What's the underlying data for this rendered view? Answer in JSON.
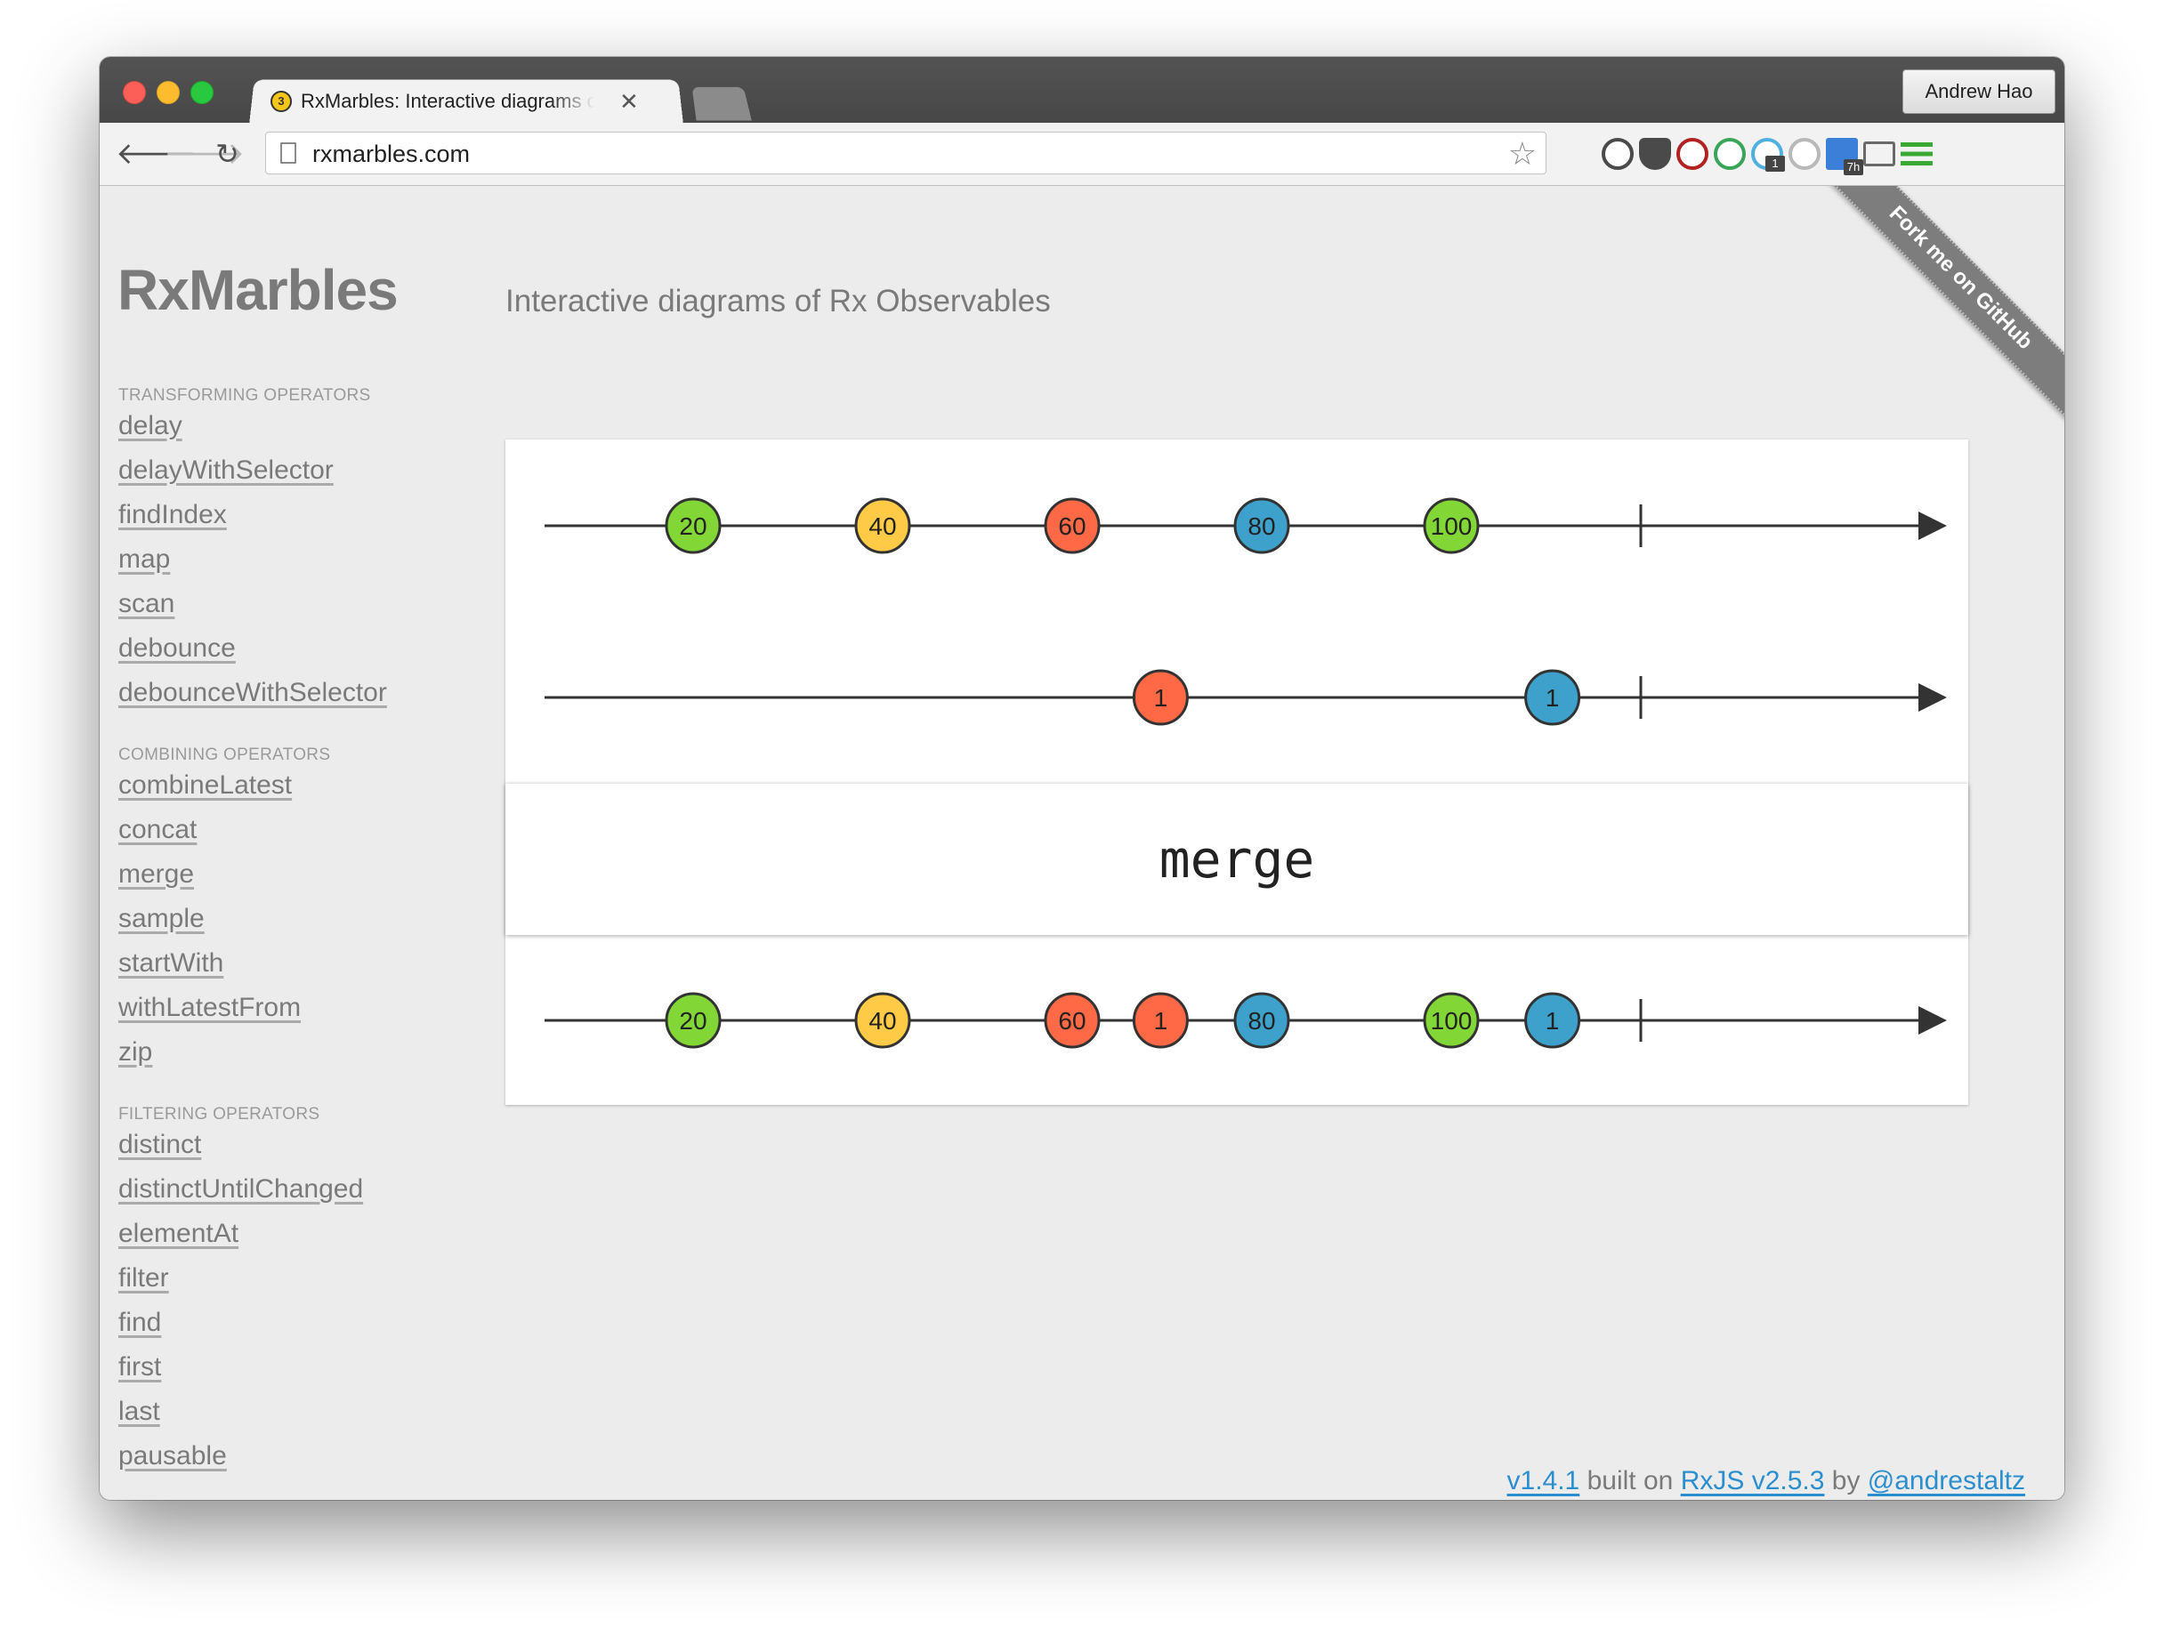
{
  "browser": {
    "tab_title": "RxMarbles: Interactive diagrams of Rx Observables",
    "tab_badge": "3",
    "profile_name": "Andrew Hao",
    "url": "rxmarbles.com",
    "extensions": [
      {
        "name": "1password-icon",
        "color": "#4a4a4a"
      },
      {
        "name": "pocket-icon",
        "color": "#4a4a4a"
      },
      {
        "name": "couch-icon",
        "color": "#b22222"
      },
      {
        "name": "pushbullet-icon",
        "color": "#3aa55a"
      },
      {
        "name": "ghostery-icon",
        "color": "#4fb0e0",
        "badge": "1"
      },
      {
        "name": "power-icon",
        "color": "#b8b8b8"
      },
      {
        "name": "calendar-icon",
        "color": "#3b7fd9",
        "badge": "7h"
      },
      {
        "name": "cast-icon",
        "color": "#6a6a6a"
      },
      {
        "name": "menu-icon",
        "color": "#3aaa35"
      }
    ]
  },
  "page": {
    "logo": "RxMarbles",
    "subtitle": "Interactive diagrams of Rx Observables",
    "ribbon": "Fork me on GitHub",
    "groups": [
      {
        "title": "TRANSFORMING OPERATORS",
        "items": [
          "delay",
          "delayWithSelector",
          "findIndex",
          "map",
          "scan",
          "debounce",
          "debounceWithSelector"
        ]
      },
      {
        "title": "COMBINING OPERATORS",
        "items": [
          "combineLatest",
          "concat",
          "merge",
          "sample",
          "startWith",
          "withLatestFrom",
          "zip"
        ]
      },
      {
        "title": "FILTERING OPERATORS",
        "items": [
          "distinct",
          "distinctUntilChanged",
          "elementAt",
          "filter",
          "find",
          "first",
          "last",
          "pausable"
        ]
      }
    ],
    "footer": {
      "version": "v1.4.1",
      "built_on": "built on",
      "rxjs": "RxJS v2.5.3",
      "by": "by",
      "author": "@andrestaltz"
    }
  },
  "diagram": {
    "operator": "merge",
    "colors": {
      "green": "#82d736",
      "yellow": "#ffcb46",
      "red": "#ff6946",
      "blue": "#3ea1cb"
    },
    "time_max": 100,
    "inputs": [
      {
        "marbles": [
          {
            "time": 5,
            "label": "20",
            "color": "green"
          },
          {
            "time": 20,
            "label": "40",
            "color": "yellow"
          },
          {
            "time": 35,
            "label": "60",
            "color": "red"
          },
          {
            "time": 50,
            "label": "80",
            "color": "blue"
          },
          {
            "time": 65,
            "label": "100",
            "color": "green"
          }
        ],
        "end": 80
      },
      {
        "marbles": [
          {
            "time": 42,
            "label": "1",
            "color": "red"
          },
          {
            "time": 73,
            "label": "1",
            "color": "blue"
          }
        ],
        "end": 80
      }
    ],
    "output": {
      "marbles": [
        {
          "time": 5,
          "label": "20",
          "color": "green"
        },
        {
          "time": 20,
          "label": "40",
          "color": "yellow"
        },
        {
          "time": 35,
          "label": "60",
          "color": "red"
        },
        {
          "time": 42,
          "label": "1",
          "color": "red"
        },
        {
          "time": 50,
          "label": "80",
          "color": "blue"
        },
        {
          "time": 65,
          "label": "100",
          "color": "green"
        },
        {
          "time": 73,
          "label": "1",
          "color": "blue"
        }
      ],
      "end": 80
    }
  }
}
